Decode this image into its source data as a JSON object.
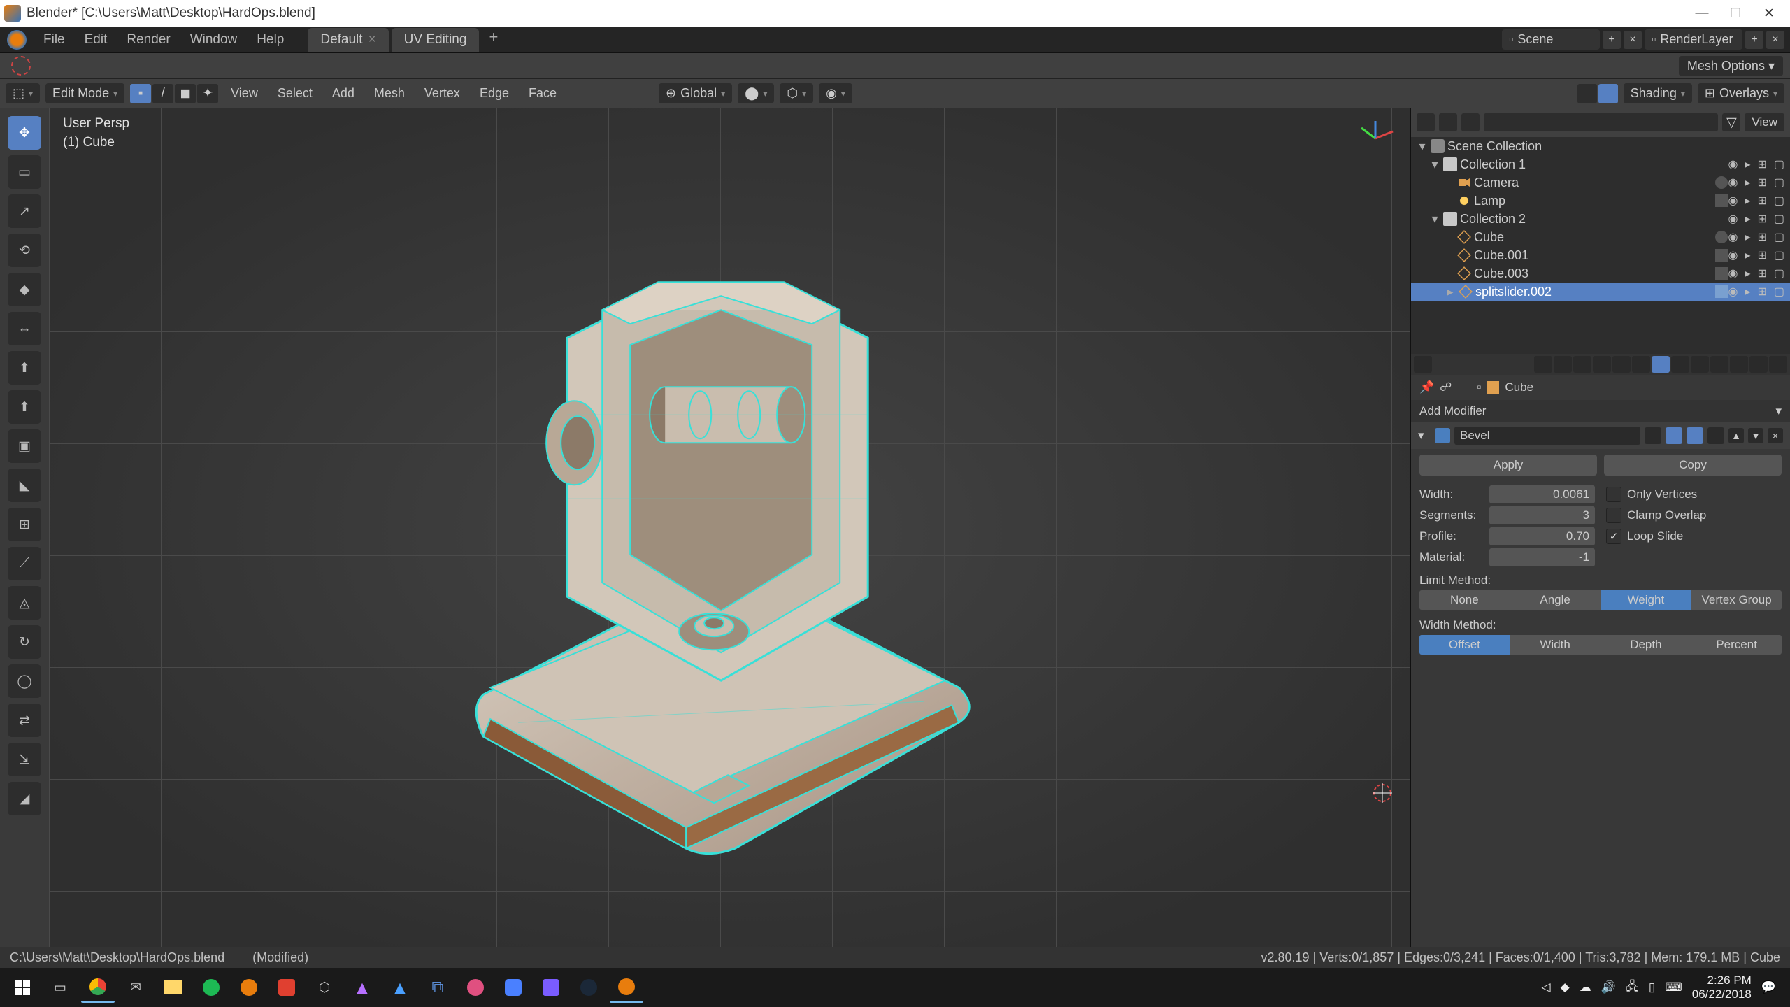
{
  "title": "Blender* [C:\\Users\\Matt\\Desktop\\HardOps.blend]",
  "menubar": {
    "file": "File",
    "edit": "Edit",
    "render": "Render",
    "window": "Window",
    "help": "Help"
  },
  "workspaces": {
    "default": "Default",
    "uv": "UV Editing"
  },
  "scene_field": "Scene",
  "layer_field": "RenderLayer",
  "mesh_options": "Mesh Options",
  "mode": "Edit Mode",
  "view_menu": {
    "view": "View",
    "select": "Select",
    "add": "Add",
    "mesh": "Mesh",
    "vertex": "Vertex",
    "edge": "Edge",
    "face": "Face"
  },
  "orientation": "Global",
  "shading_label": "Shading",
  "overlays_label": "Overlays",
  "outliner_view_btn": "View",
  "viewport_info": {
    "persp": "User Persp",
    "obj": "(1) Cube"
  },
  "outliner": {
    "scene": "Scene Collection",
    "c1": "Collection 1",
    "cam": "Camera",
    "lamp": "Lamp",
    "c2": "Collection 2",
    "cube": "Cube",
    "cube001": "Cube.001",
    "cube003": "Cube.003",
    "split": "splitslider.002"
  },
  "properties": {
    "breadcrumb": "Cube",
    "add_modifier": "Add Modifier",
    "mod_name": "Bevel",
    "apply": "Apply",
    "copy": "Copy",
    "width_lbl": "Width:",
    "width_val": "0.0061",
    "segments_lbl": "Segments:",
    "segments_val": "3",
    "profile_lbl": "Profile:",
    "profile_val": "0.70",
    "material_lbl": "Material:",
    "material_val": "-1",
    "only_vertices": "Only Vertices",
    "clamp_overlap": "Clamp Overlap",
    "loop_slide": "Loop Slide",
    "limit_method": "Limit Method:",
    "limit_none": "None",
    "limit_angle": "Angle",
    "limit_weight": "Weight",
    "limit_vgroup": "Vertex Group",
    "width_method": "Width Method:",
    "wm_offset": "Offset",
    "wm_width": "Width",
    "wm_depth": "Depth",
    "wm_percent": "Percent"
  },
  "status": {
    "path": "C:\\Users\\Matt\\Desktop\\HardOps.blend",
    "modified": "(Modified)",
    "stats": "v2.80.19 | Verts:0/1,857 | Edges:0/3,241 | Faces:0/1,400 | Tris:3,782 | Mem: 179.1 MB | Cube"
  },
  "taskbar": {
    "time": "2:26 PM",
    "date": "06/22/2018"
  }
}
